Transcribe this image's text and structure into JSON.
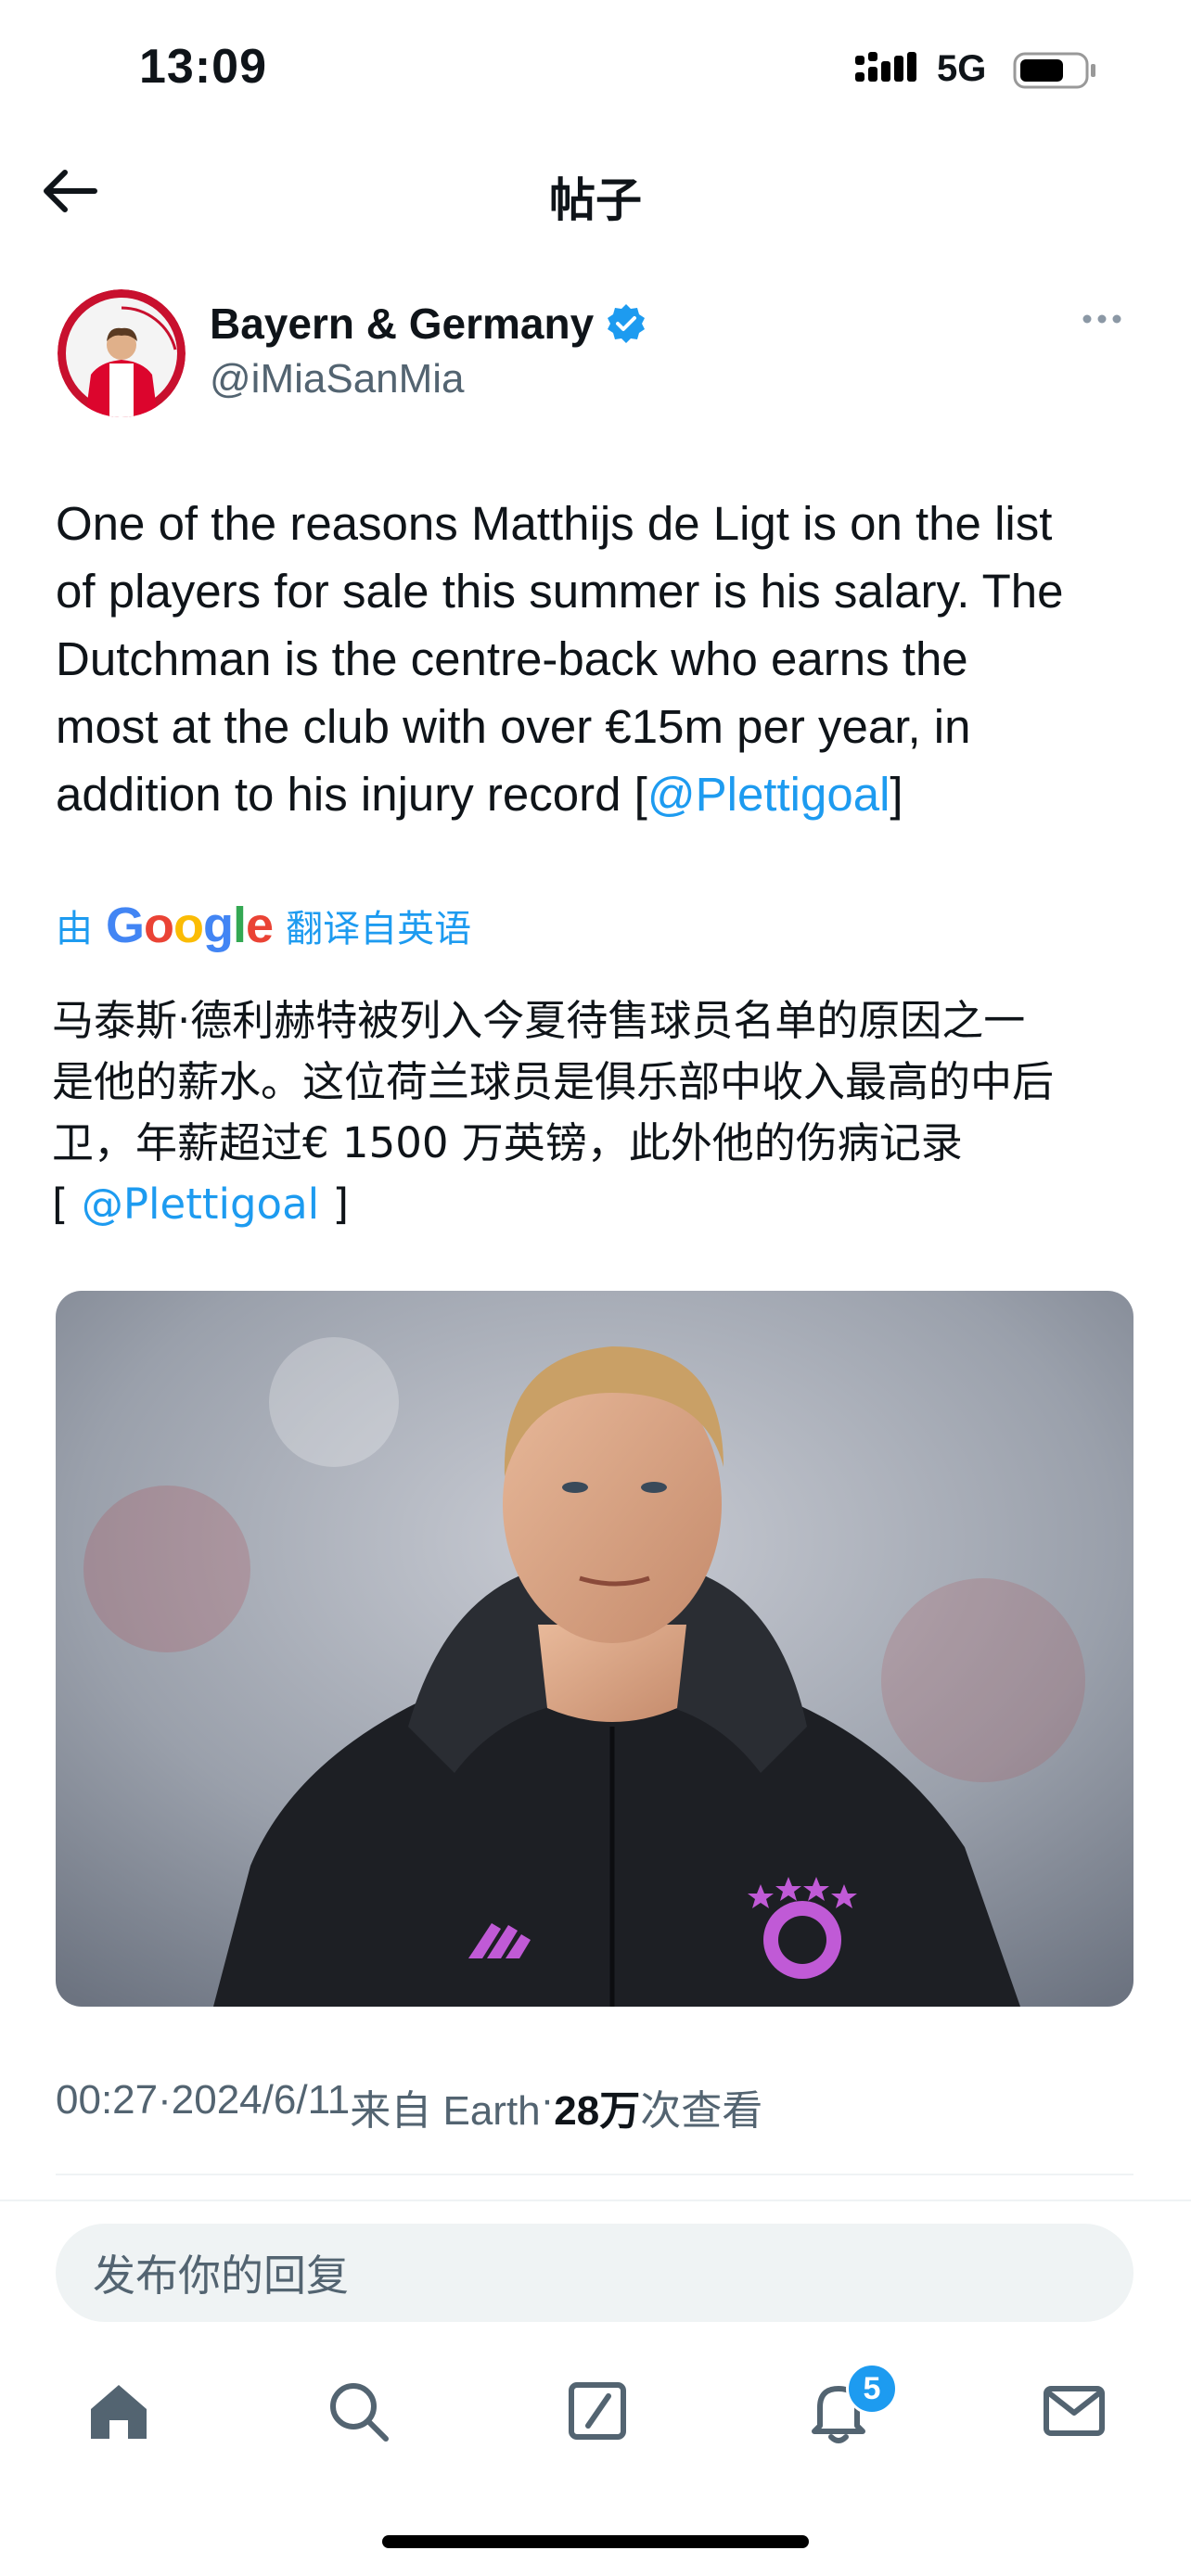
{
  "status_bar": {
    "time": "13:09",
    "network": "5G",
    "battery_level": 0.7
  },
  "header": {
    "title": "帖子",
    "back_icon": "arrow-left-icon"
  },
  "post": {
    "author": {
      "display_name": "Bayern & Germany",
      "handle": "@iMiaSanMia",
      "verified": true
    },
    "text_before_link": "One of the reasons Matthijs de Ligt is on the list\nof players for sale this summer is his salary. The\nDutchman is the centre-back who earns the\nmost at the club with over €15m per year, in\naddition to his injury record [",
    "text_link": "@Plettigoal",
    "text_after_link": "]",
    "translation": {
      "prefix": "由",
      "brand": "Google",
      "suffix": "翻译自英语",
      "text": "马泰斯·德利赫特被列入今夏待售球员名单的原因之一\n是他的薪水。这位荷兰球员是俱乐部中收入最高的中后\n卫，年薪超过€ 1500 万英镑，此外他的伤病记录\n[ ",
      "link": "@Plettigoal",
      "end": " ]"
    },
    "meta": {
      "time": "00:27",
      "sep1": " · ",
      "date": "2024/6/11",
      "source": " 来自 Earth",
      "sep2": " · ",
      "views_count": "28万",
      "views_label": " 次查看"
    }
  },
  "reply": {
    "placeholder": "发布你的回复"
  },
  "tab_bar": {
    "items": [
      "home-icon",
      "search-icon",
      "compose-icon",
      "notifications-icon",
      "messages-icon"
    ],
    "notifications_badge": "5"
  },
  "colors": {
    "accent": "#1d9bf0",
    "muted": "#536471",
    "text": "#0f1419"
  }
}
